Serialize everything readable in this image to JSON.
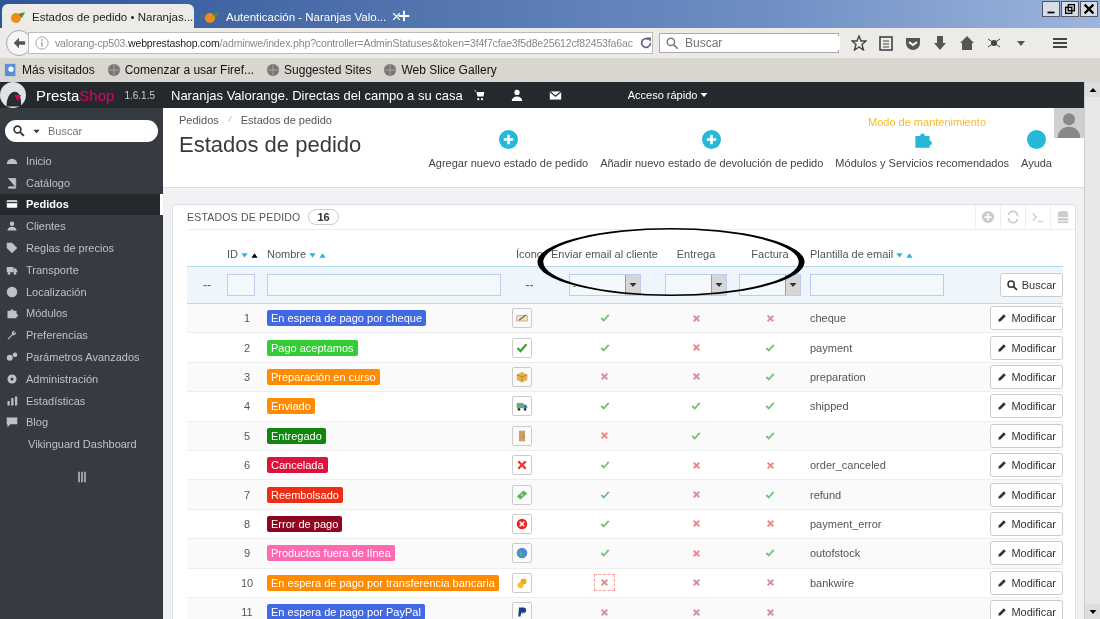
{
  "browser": {
    "tabs": [
      {
        "title": "Estados de pedido • Naranjas...",
        "selected": true
      },
      {
        "title": "Autenticación - Naranjas Valo...",
        "selected": false
      }
    ],
    "url": {
      "subdomain": "valorang-cp503.",
      "domain": "webprestashop.com",
      "path": "/adminwe/index.php?controller=AdminStatuses&token=3f4f7cfae3f5d8e25612cf82453fa6ac"
    },
    "search_placeholder": "Buscar",
    "bookmarks": [
      {
        "label": "Más visitados",
        "kind": "search"
      },
      {
        "label": "Comenzar a usar Firef...",
        "kind": "globe"
      },
      {
        "label": "Suggested Sites",
        "kind": "globe"
      },
      {
        "label": "Web Slice Gallery",
        "kind": "globe"
      }
    ]
  },
  "header": {
    "logo_first": "Presta",
    "logo_second": "Shop",
    "version": "1.6.1.5",
    "shop_name": "Naranjas Valorange. Directas del campo a su casa",
    "quick_access": "Acceso rápido"
  },
  "sidebar": {
    "search_placeholder": "Buscar",
    "items": [
      {
        "label": "Inicio",
        "kind": "dashboard",
        "selected": false
      },
      {
        "label": "Catálogo",
        "kind": "book",
        "selected": false
      },
      {
        "label": "Pedidos",
        "kind": "card",
        "selected": true
      },
      {
        "label": "Clientes",
        "kind": "users",
        "selected": false
      },
      {
        "label": "Reglas de precios",
        "kind": "tag",
        "selected": false
      },
      {
        "label": "Transporte",
        "kind": "truck",
        "selected": false
      },
      {
        "label": "Localización",
        "kind": "globe",
        "selected": false
      },
      {
        "label": "Módulos",
        "kind": "puzzle",
        "selected": false
      },
      {
        "label": "Preferencias",
        "kind": "wrench",
        "selected": false
      },
      {
        "label": "Parámetros Avanzados",
        "kind": "gears",
        "selected": false
      },
      {
        "label": "Administración",
        "kind": "gear",
        "selected": false
      },
      {
        "label": "Estadísticas",
        "kind": "chart",
        "selected": false
      },
      {
        "label": "Blog",
        "kind": "comment",
        "selected": false
      },
      {
        "label": "Vikinguard Dashboard",
        "kind": "none",
        "selected": false
      }
    ]
  },
  "page": {
    "breadcrumb": [
      "Pedidos",
      "Estados de pedido"
    ],
    "title": "Estados de pedido",
    "maintenance": "Modo de mantenimiento",
    "toolbar": [
      {
        "label": "Agregar nuevo estado de pedido",
        "kind": "plus"
      },
      {
        "label": "Añadir nuevo estado de devolución de pedido",
        "kind": "plus"
      },
      {
        "label": "Módulos y Servicios recomendados",
        "kind": "puzzle"
      },
      {
        "label": "Ayuda",
        "kind": "help"
      }
    ]
  },
  "panel": {
    "title": "ESTADOS DE PEDIDO",
    "count": "16",
    "columns": [
      {
        "label": "ID",
        "sortable": true,
        "sorted": true
      },
      {
        "label": "Nombre",
        "sortable": true,
        "sorted": false
      },
      {
        "label": "Ícono",
        "sortable": false
      },
      {
        "label": "Enviar email al cliente",
        "sortable": false
      },
      {
        "label": "Entrega",
        "sortable": false
      },
      {
        "label": "Factura",
        "sortable": false
      },
      {
        "label": "Plantilla de email",
        "sortable": true,
        "sorted": false
      }
    ],
    "filter": {
      "lead": "--",
      "icon": "--",
      "email_value": "-",
      "search_button": "Buscar"
    },
    "rows": [
      {
        "id": "1",
        "name": "En espera de pago por cheque",
        "color": "#4169e1",
        "kind": "cheque",
        "send_email": true,
        "delivery": false,
        "invoice": false,
        "template": "cheque",
        "focused": false,
        "action": "Modificar"
      },
      {
        "id": "2",
        "name": "Pago aceptamos",
        "color": "#32cd32",
        "kind": "check",
        "send_email": true,
        "delivery": false,
        "invoice": true,
        "template": "payment",
        "focused": false,
        "action": "Modificar"
      },
      {
        "id": "3",
        "name": "Preparación en curso",
        "color": "#ff8c00",
        "kind": "box",
        "send_email": false,
        "delivery": false,
        "invoice": true,
        "template": "preparation",
        "focused": false,
        "action": "Modificar"
      },
      {
        "id": "4",
        "name": "Enviado",
        "color": "#ff8c00",
        "kind": "truck",
        "send_email": true,
        "delivery": true,
        "invoice": true,
        "template": "shipped",
        "focused": false,
        "action": "Modificar"
      },
      {
        "id": "5",
        "name": "Entregado",
        "color": "#108510",
        "kind": "door",
        "send_email": false,
        "delivery": true,
        "invoice": true,
        "focused": false,
        "action": "Modificar"
      },
      {
        "id": "6",
        "name": "Cancelada",
        "color": "#dc143c",
        "kind": "cross",
        "send_email": true,
        "delivery": false,
        "invoice": false,
        "template": "order_canceled",
        "focused": false,
        "action": "Modificar"
      },
      {
        "id": "7",
        "name": "Reembolsado",
        "color": "#ec2e15",
        "kind": "money",
        "send_email": true,
        "delivery": false,
        "invoice": true,
        "template": "refund",
        "focused": false,
        "action": "Modificar"
      },
      {
        "id": "8",
        "name": "Error de pago",
        "color": "#8f0621",
        "kind": "error",
        "send_email": true,
        "delivery": false,
        "invoice": false,
        "template": "payment_error",
        "focused": false,
        "action": "Modificar"
      },
      {
        "id": "9",
        "name": "Productos fuera de línea",
        "color": "#ff69b4",
        "kind": "globe",
        "send_email": true,
        "delivery": false,
        "invoice": true,
        "template": "outofstock",
        "focused": false,
        "action": "Modificar"
      },
      {
        "id": "10",
        "name": "En espera de pago por transferencia bancaria",
        "color": "#ff8c00",
        "kind": "coins",
        "send_email": false,
        "delivery": false,
        "invoice": false,
        "template": "bankwire",
        "focused": true,
        "action": "Modificar"
      },
      {
        "id": "11",
        "name": "En espera de pago por PayPal",
        "color": "#4169e1",
        "kind": "paypal",
        "send_email": false,
        "delivery": false,
        "invoice": false,
        "focused": false,
        "action": "Modificar"
      }
    ]
  }
}
